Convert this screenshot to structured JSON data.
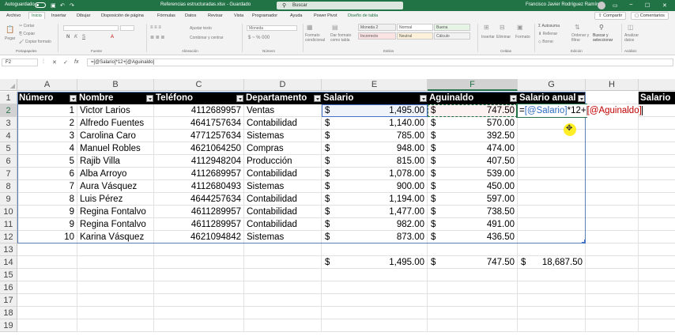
{
  "titlebar": {
    "autosave_label": "Autoguardado",
    "file_title": "Referencias estructuradas.xlsx  -  Guardado",
    "search_placeholder": "Buscar",
    "user_name": "Francisco Javier Rodríguez Ramírez"
  },
  "menubar": {
    "tabs": [
      "Archivo",
      "Inicio",
      "Insertar",
      "Dibujar",
      "Disposición de página",
      "Fórmulas",
      "Datos",
      "Revisar",
      "Vista",
      "Programador",
      "Ayuda",
      "Power Pivot",
      "Diseño de tabla"
    ],
    "active_index": 1,
    "share_label": "Compartir",
    "comments_label": "Comentarios"
  },
  "ribbon": {
    "clipboard": {
      "paste": "Pegar",
      "cut": "Cortar",
      "copy": "Copiar",
      "format_painter": "Copiar formato",
      "group": "Portapapeles"
    },
    "groups": [
      "Fuente",
      "Alineación",
      "Número",
      "Estilos",
      "Celdas",
      "Edición",
      "Análisis"
    ],
    "wrap_text": "Ajustar texto",
    "merge_center": "Combinar y centrar",
    "number_format": "Moneda",
    "cond_format": "Formato condicional",
    "format_table": "Dar formato como tabla",
    "styles": [
      "Moneda 2",
      "Normal",
      "Buena",
      "Incorrecto",
      "Neutral",
      "Cálculo"
    ],
    "insert": "Insertar",
    "delete": "Eliminar",
    "format": "Formato",
    "autosum": "Autosuma",
    "fill": "Rellenar",
    "clear": "Borrar",
    "sort_filter": "Ordenar y filtrar",
    "find_select": "Buscar y seleccionar",
    "analyze": "Analizar datos"
  },
  "formulabar": {
    "name_box": "F2",
    "cancel": "✕",
    "enter": "✓",
    "fx": "fx",
    "formula": "=[@Salario]*12+[@Aguinaldo]"
  },
  "sheet": {
    "columns": [
      "A",
      "B",
      "C",
      "D",
      "E",
      "F",
      "G",
      "H"
    ],
    "rows": [
      "1",
      "2",
      "3",
      "4",
      "5",
      "6",
      "7",
      "8",
      "9",
      "10",
      "11",
      "12",
      "13",
      "14",
      "15",
      "16",
      "17",
      "18",
      "19"
    ],
    "headers": [
      "Número",
      "Nombre",
      "Teléfono",
      "Departamento",
      "Salario",
      "Aguinaldo",
      "Salario anual"
    ],
    "extra_header": "Salario",
    "currency": "$",
    "data": [
      {
        "num": "1",
        "name": "Victor Larios",
        "phone": "4112689957",
        "dept": "Ventas",
        "salary": "1,495.00",
        "bonus": "747.50"
      },
      {
        "num": "2",
        "name": "Alfredo Fuentes",
        "phone": "4641757634",
        "dept": "Contabilidad",
        "salary": "1,140.00",
        "bonus": "570.00"
      },
      {
        "num": "3",
        "name": "Carolina Caro",
        "phone": "4771257634",
        "dept": "Sistemas",
        "salary": "785.00",
        "bonus": "392.50"
      },
      {
        "num": "4",
        "name": "Manuel Robles",
        "phone": "4621064250",
        "dept": "Compras",
        "salary": "948.00",
        "bonus": "474.00"
      },
      {
        "num": "5",
        "name": "Rajib Villa",
        "phone": "4112948204",
        "dept": "Producción",
        "salary": "815.00",
        "bonus": "407.50"
      },
      {
        "num": "6",
        "name": "Alba Arroyo",
        "phone": "4112689957",
        "dept": "Contabilidad",
        "salary": "1,078.00",
        "bonus": "539.00"
      },
      {
        "num": "7",
        "name": "Aura Vásquez",
        "phone": "4112680493",
        "dept": "Sistemas",
        "salary": "900.00",
        "bonus": "450.00"
      },
      {
        "num": "8",
        "name": "Luis Pérez",
        "phone": "4644257634",
        "dept": "Contabilidad",
        "salary": "1,194.00",
        "bonus": "597.00"
      },
      {
        "num": "9",
        "name": "Regina Fontalvo",
        "phone": "4611289957",
        "dept": "Contabilidad",
        "salary": "1,477.00",
        "bonus": "738.50"
      },
      {
        "num": "9",
        "name": "Regina Fontalvo",
        "phone": "4611289957",
        "dept": "Contabilidad",
        "salary": "982.00",
        "bonus": "491.00"
      },
      {
        "num": "10",
        "name": "Karina Vásquez",
        "phone": "4621094842",
        "dept": "Sistemas",
        "salary": "873.00",
        "bonus": "436.50"
      }
    ],
    "editing": {
      "eq": "=",
      "ref1": "[@Salario]",
      "mid": "*12+",
      "ref2": "[@Aguinaldo]"
    },
    "totals": {
      "salary": "1,495.00",
      "bonus": "747.50",
      "annual": "18,687.50"
    }
  }
}
